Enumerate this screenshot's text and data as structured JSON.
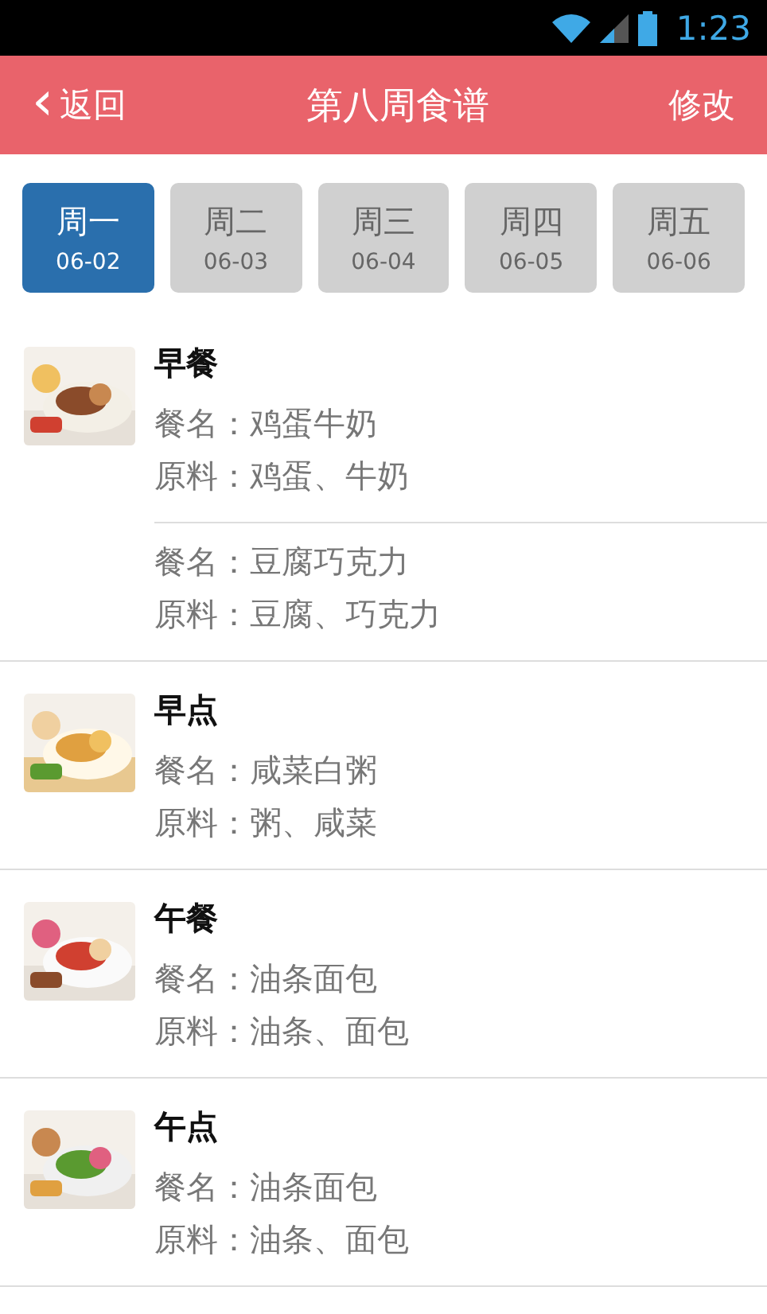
{
  "status_bar": {
    "time": "1:23"
  },
  "header": {
    "back": "返回",
    "back_icon": "‹",
    "title": "第八周食谱",
    "action": "修改"
  },
  "days": [
    {
      "day": "周一",
      "date": "06-02",
      "selected": true
    },
    {
      "day": "周二",
      "date": "06-03",
      "selected": false
    },
    {
      "day": "周三",
      "date": "06-04",
      "selected": false
    },
    {
      "day": "周四",
      "date": "06-05",
      "selected": false
    },
    {
      "day": "周五",
      "date": "06-06",
      "selected": false
    }
  ],
  "meals": [
    {
      "title": "早餐",
      "image": {
        "kind": "picture"
      },
      "dishes": [
        {
          "name": "餐名：鸡蛋牛奶",
          "ingredients": "原料：鸡蛋、牛奶"
        },
        {
          "name": "餐名：豆腐巧克力",
          "ingredients": "原料：豆腐、巧克力"
        }
      ]
    },
    {
      "title": "早点",
      "image": {
        "kind": "picture"
      },
      "dishes": [
        {
          "name": "餐名：咸菜白粥",
          "ingredients": "原料：粥、咸菜"
        }
      ]
    },
    {
      "title": "午餐",
      "image": {
        "kind": "picture"
      },
      "dishes": [
        {
          "name": "餐名：油条面包",
          "ingredients": "原料：油条、面包"
        }
      ]
    },
    {
      "title": "午点",
      "image": {
        "kind": "picture"
      },
      "dishes": [
        {
          "name": "餐名：油条面包",
          "ingredients": "原料：油条、面包"
        }
      ]
    }
  ]
}
